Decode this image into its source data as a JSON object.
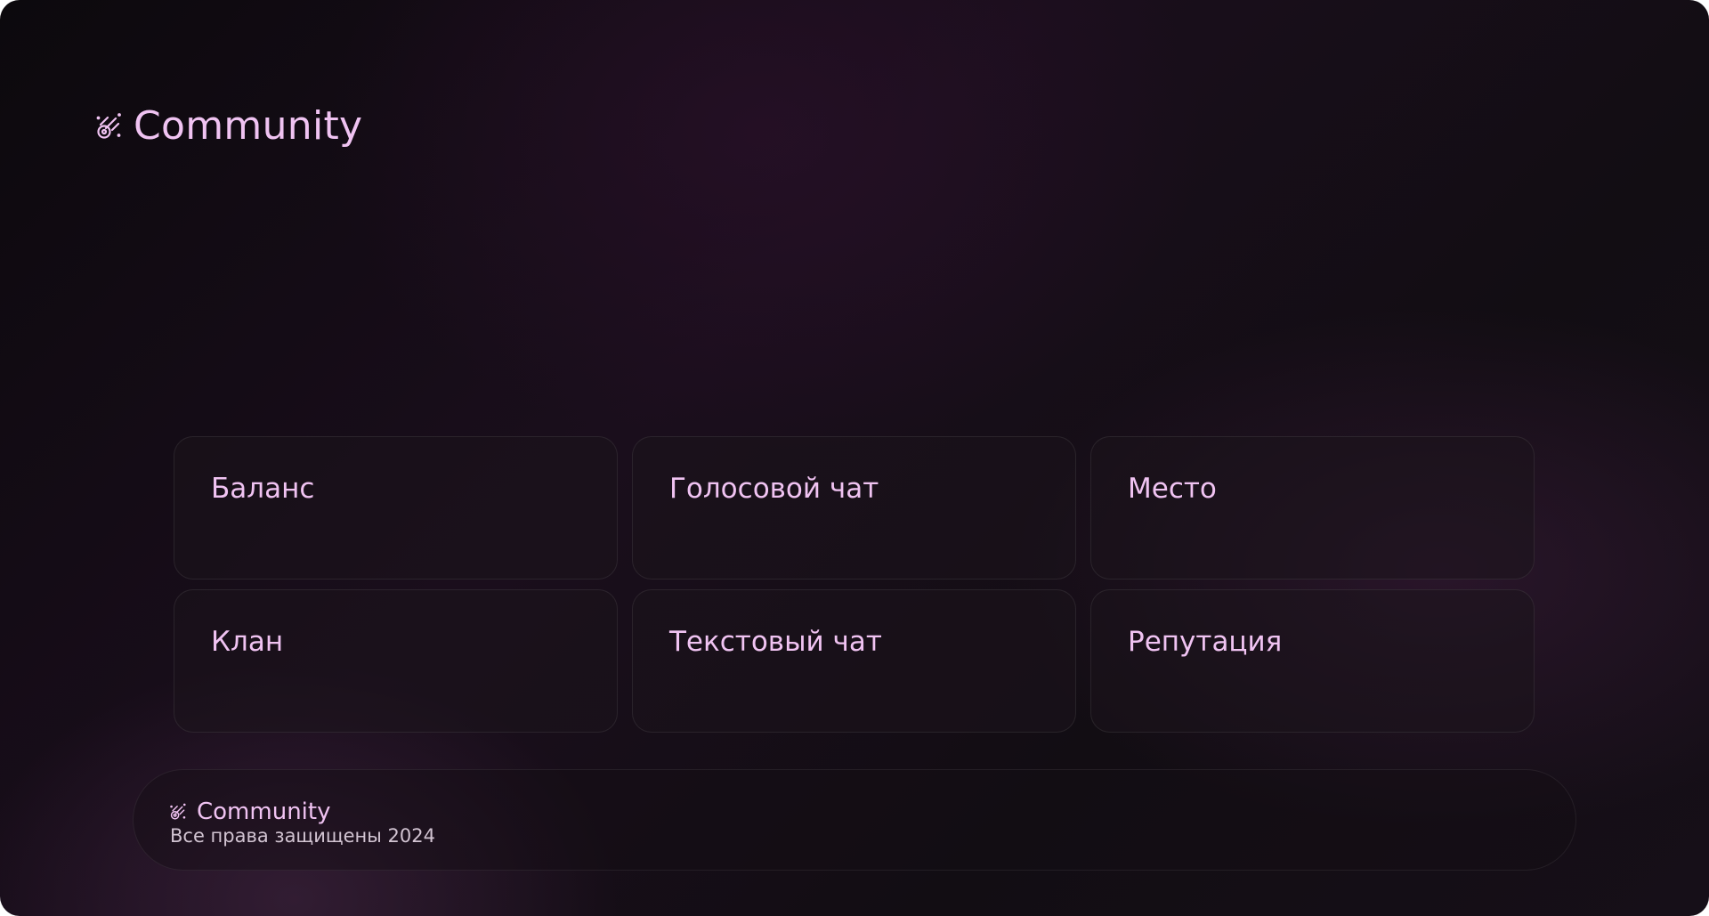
{
  "brand": {
    "name": "Community",
    "icon": "meteor-icon",
    "accent_color": "#f0c3f2"
  },
  "cards": [
    {
      "label": "Баланс"
    },
    {
      "label": "Голосовой чат"
    },
    {
      "label": "Место"
    },
    {
      "label": "Клан"
    },
    {
      "label": "Текстовый чат"
    },
    {
      "label": "Репутация"
    }
  ],
  "footer": {
    "brand_name": "Community",
    "copyright": "Все права защищены 2024"
  }
}
